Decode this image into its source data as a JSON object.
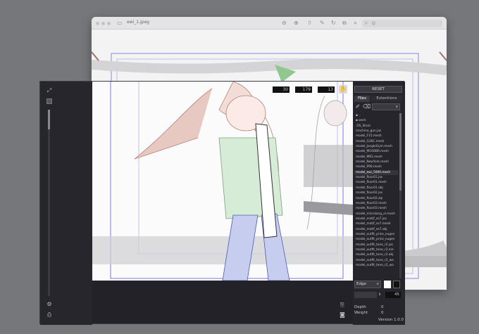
{
  "preview": {
    "title": "ewi_1.jpeg",
    "search_placeholder": "Q",
    "icons": [
      "sidebar-icon",
      "zoom-out-icon",
      "zoom-in-icon",
      "share-icon",
      "markup-icon",
      "rotate-icon",
      "more-icon"
    ]
  },
  "toolbar": {
    "values": [
      "30",
      "179",
      "13"
    ],
    "reset_label": "RESET"
  },
  "tabs": [
    {
      "label": "Files",
      "active": true
    },
    {
      "label": "Extentions",
      "active": false
    }
  ],
  "files": [
    {
      "name": "..",
      "type": "dir"
    },
    {
      "name": "work",
      "type": "dir"
    },
    {
      "name": ".DS_Store"
    },
    {
      "name": "machine_gun.jas"
    },
    {
      "name": "model_F15.mesh"
    },
    {
      "name": "model_G36C.mesh"
    },
    {
      "name": "model_JungleGym.mesh"
    },
    {
      "name": "model_M16DBR.mesh"
    },
    {
      "name": "model_M81.mesh"
    },
    {
      "name": "model_NewYork.mesh"
    },
    {
      "name": "model_P90.mesh"
    },
    {
      "name": "model_ewi_5000.mesh",
      "selected": true
    },
    {
      "name": "model_floor01.jas"
    },
    {
      "name": "model_floor01.mesh"
    },
    {
      "name": "model_floor01.obj"
    },
    {
      "name": "model_floor02.jas"
    },
    {
      "name": "model_floor02.zip"
    },
    {
      "name": "model_floor03.mesh"
    },
    {
      "name": "model_floor03.mesh"
    },
    {
      "name": "model_microkorg_xl.mesh"
    },
    {
      "name": "model_motif_es7.jas"
    },
    {
      "name": "model_motif_es7.mesh"
    },
    {
      "name": "model_motif_es7.obj"
    },
    {
      "name": "model_outfit_prinz_eugen"
    },
    {
      "name": "model_outfit_prinz_eugen"
    },
    {
      "name": "model_outfit_tone_r2.jas"
    },
    {
      "name": "model_outfit_tone_r2.me"
    },
    {
      "name": "model_outfit_tone_r2.obj"
    },
    {
      "name": "model_outfit_tone_r2_wa"
    },
    {
      "name": "model_outfit_tone_r2_wa"
    }
  ],
  "edge_select": "Edge",
  "size_value": "45",
  "params": [
    {
      "label": "Depth",
      "value": "0"
    },
    {
      "label": "Weight",
      "value": "0"
    }
  ],
  "version": "Version 1.0.0",
  "colors": {
    "app_bg": "#222228",
    "panel_bg": "#25252b",
    "desktop": "#76777b",
    "accent": "#4a4ad0"
  }
}
